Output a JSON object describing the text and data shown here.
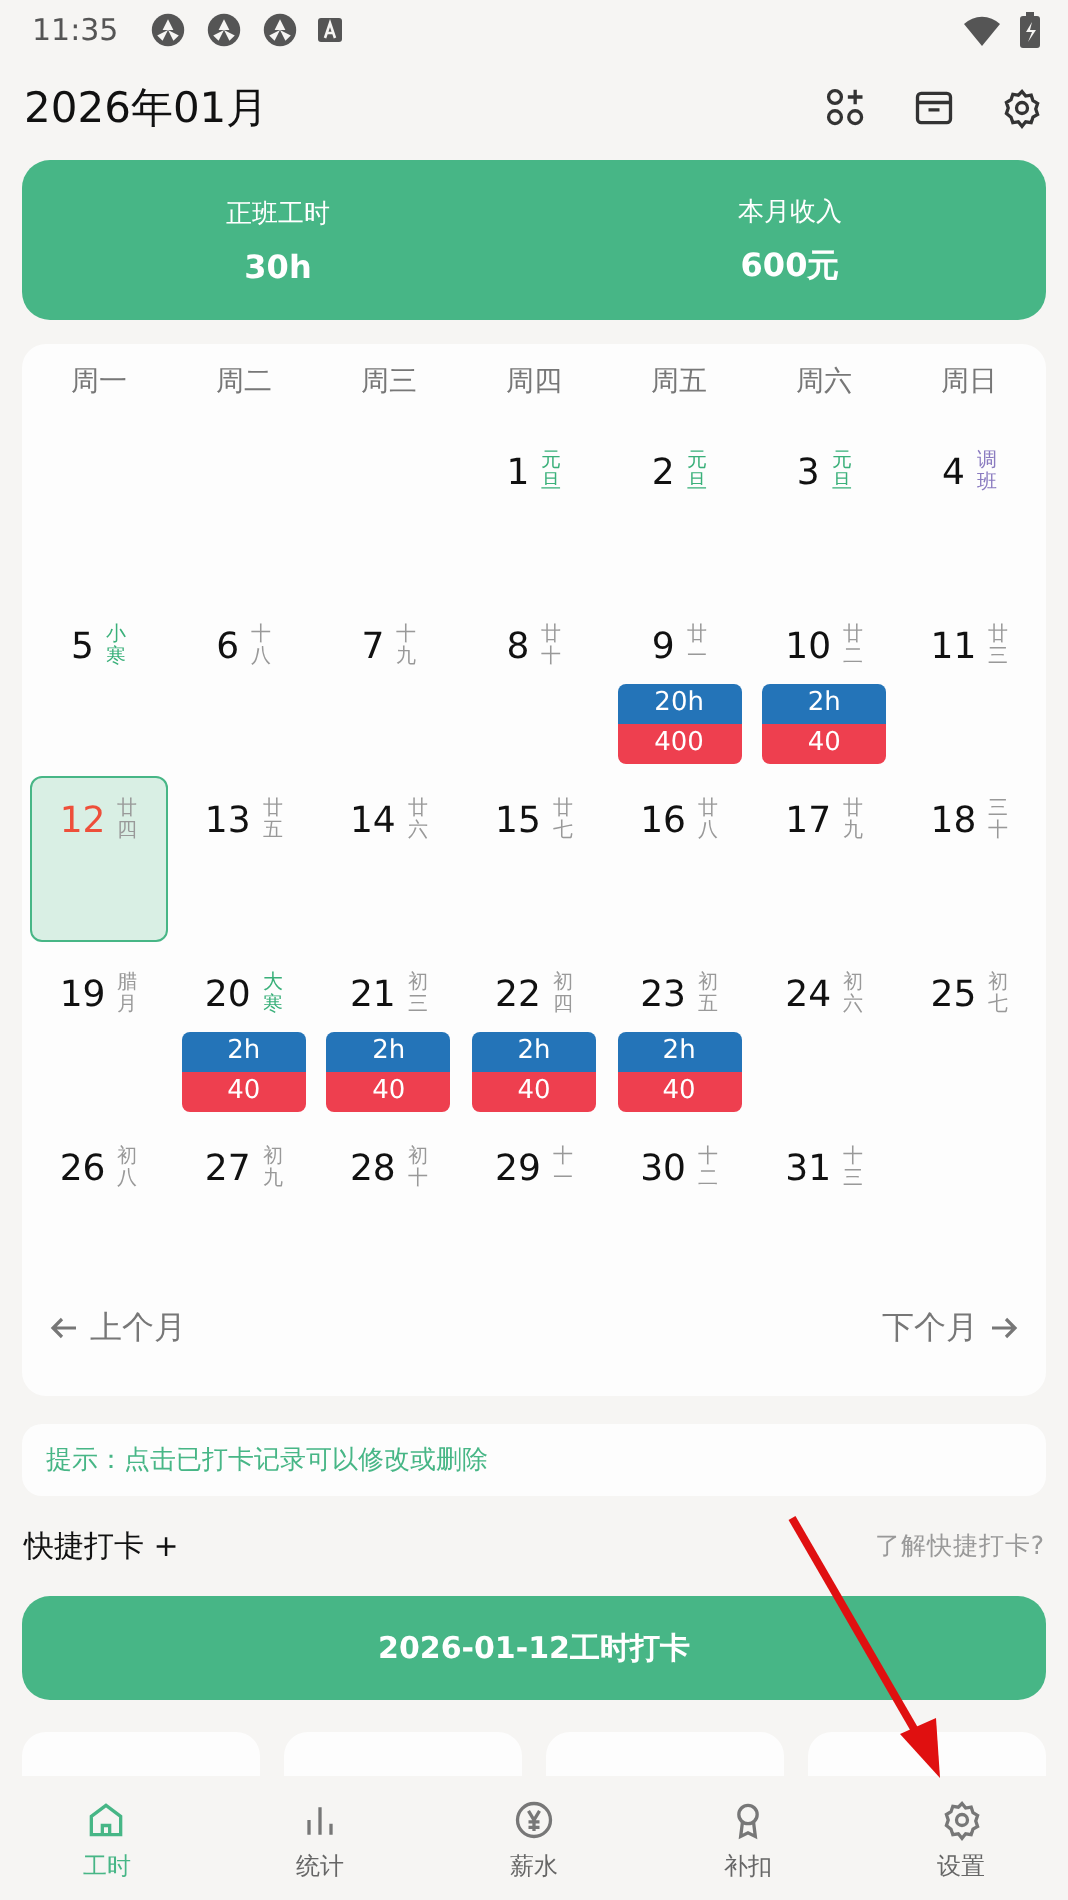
{
  "status_bar": {
    "time": "11:35"
  },
  "header": {
    "title": "2026年01月"
  },
  "summary": [
    {
      "label": "正班工时",
      "value": "30h"
    },
    {
      "label": "本月收入",
      "value": "600元"
    }
  ],
  "calendar": {
    "weekdays": [
      "周一",
      "周二",
      "周三",
      "周四",
      "周五",
      "周六",
      "周日"
    ],
    "weeks": [
      [
        {
          "kind": "blank"
        },
        {
          "kind": "blank"
        },
        {
          "kind": "blank"
        },
        {
          "kind": "day",
          "day": "1",
          "lunar": "元旦",
          "color": "#3ab07a",
          "selected": false
        },
        {
          "kind": "day",
          "day": "2",
          "lunar": "元旦",
          "color": "#3ab07a",
          "selected": false
        },
        {
          "kind": "day",
          "day": "3",
          "lunar": "元旦",
          "color": "#3ab07a",
          "selected": false
        },
        {
          "kind": "day",
          "day": "4",
          "lunar": "调班",
          "color": "#8a7bc0",
          "selected": false
        }
      ],
      [
        {
          "kind": "day",
          "day": "5",
          "lunar": "小寒",
          "color": "#3ab07a",
          "selected": false
        },
        {
          "kind": "day",
          "day": "6",
          "lunar": "十八",
          "color": "#999999",
          "selected": false
        },
        {
          "kind": "day",
          "day": "7",
          "lunar": "十九",
          "color": "#999999",
          "selected": false
        },
        {
          "kind": "day",
          "day": "8",
          "lunar": "廿十",
          "color": "#999999",
          "selected": false
        },
        {
          "kind": "day",
          "day": "9",
          "lunar": "廿一",
          "color": "#999999",
          "selected": false,
          "record": {
            "hours": "20h",
            "pay": "400"
          }
        },
        {
          "kind": "day",
          "day": "10",
          "lunar": "廿二",
          "color": "#999999",
          "selected": false,
          "record": {
            "hours": "2h",
            "pay": "40"
          }
        },
        {
          "kind": "day",
          "day": "11",
          "lunar": "廿三",
          "color": "#999999",
          "selected": false
        }
      ],
      [
        {
          "kind": "day",
          "day": "12",
          "lunar": "廿四",
          "color": "#999999",
          "selected": true
        },
        {
          "kind": "day",
          "day": "13",
          "lunar": "廿五",
          "color": "#999999",
          "selected": false
        },
        {
          "kind": "day",
          "day": "14",
          "lunar": "廿六",
          "color": "#999999",
          "selected": false
        },
        {
          "kind": "day",
          "day": "15",
          "lunar": "廿七",
          "color": "#999999",
          "selected": false
        },
        {
          "kind": "day",
          "day": "16",
          "lunar": "廿八",
          "color": "#999999",
          "selected": false
        },
        {
          "kind": "day",
          "day": "17",
          "lunar": "廿九",
          "color": "#999999",
          "selected": false
        },
        {
          "kind": "day",
          "day": "18",
          "lunar": "三十",
          "color": "#999999",
          "selected": false
        }
      ],
      [
        {
          "kind": "day",
          "day": "19",
          "lunar": "腊月",
          "color": "#999999",
          "selected": false
        },
        {
          "kind": "day",
          "day": "20",
          "lunar": "大寒",
          "color": "#3ab07a",
          "selected": false,
          "record": {
            "hours": "2h",
            "pay": "40"
          }
        },
        {
          "kind": "day",
          "day": "21",
          "lunar": "初三",
          "color": "#999999",
          "selected": false,
          "record": {
            "hours": "2h",
            "pay": "40"
          }
        },
        {
          "kind": "day",
          "day": "22",
          "lunar": "初四",
          "color": "#999999",
          "selected": false,
          "record": {
            "hours": "2h",
            "pay": "40"
          }
        },
        {
          "kind": "day",
          "day": "23",
          "lunar": "初五",
          "color": "#999999",
          "selected": false,
          "record": {
            "hours": "2h",
            "pay": "40"
          }
        },
        {
          "kind": "day",
          "day": "24",
          "lunar": "初六",
          "color": "#999999",
          "selected": false
        },
        {
          "kind": "day",
          "day": "25",
          "lunar": "初七",
          "color": "#999999",
          "selected": false
        }
      ],
      [
        {
          "kind": "day",
          "day": "26",
          "lunar": "初八",
          "color": "#999999",
          "selected": false
        },
        {
          "kind": "day",
          "day": "27",
          "lunar": "初九",
          "color": "#999999",
          "selected": false
        },
        {
          "kind": "day",
          "day": "28",
          "lunar": "初十",
          "color": "#999999",
          "selected": false
        },
        {
          "kind": "day",
          "day": "29",
          "lunar": "十一",
          "color": "#999999",
          "selected": false
        },
        {
          "kind": "day",
          "day": "30",
          "lunar": "十二",
          "color": "#999999",
          "selected": false
        },
        {
          "kind": "day",
          "day": "31",
          "lunar": "十三",
          "color": "#999999",
          "selected": false
        },
        {
          "kind": "blank"
        }
      ]
    ],
    "prev": "上个月",
    "next": "下个月"
  },
  "tip": "提示：点击已打卡记录可以修改或删除",
  "quick": {
    "title": "快捷打卡 +",
    "help": "了解快捷打卡?"
  },
  "punch_button": "2026-01-12工时打卡",
  "bottom_nav": [
    {
      "label": "工时",
      "kind": "home",
      "selected": true
    },
    {
      "label": "统计",
      "kind": "chart",
      "selected": false
    },
    {
      "label": "薪水",
      "kind": "yen",
      "selected": false
    },
    {
      "label": "补扣",
      "kind": "ribbon",
      "selected": false
    },
    {
      "label": "设置",
      "kind": "gear",
      "selected": false
    }
  ]
}
